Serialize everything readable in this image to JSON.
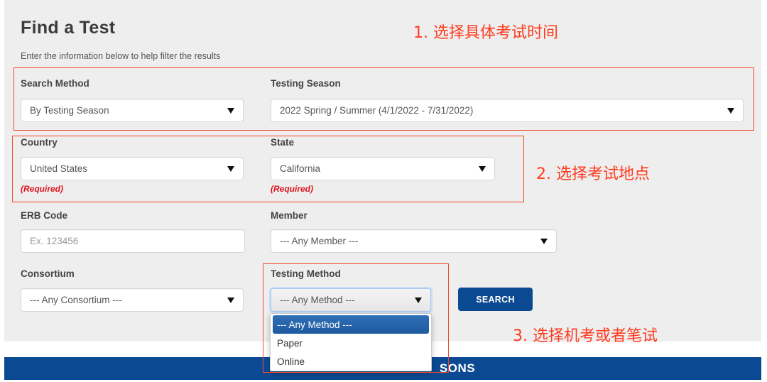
{
  "page": {
    "title": "Find a Test",
    "subtitle": "Enter the information below to help filter the results"
  },
  "fields": {
    "search_method": {
      "label": "Search Method",
      "value": "By Testing Season"
    },
    "testing_season": {
      "label": "Testing Season",
      "value": "2022 Spring / Summer (4/1/2022 - 7/31/2022)"
    },
    "country": {
      "label": "Country",
      "value": "United States",
      "note": "(Required)"
    },
    "state": {
      "label": "State",
      "value": "California",
      "note": "(Required)"
    },
    "erb_code": {
      "label": "ERB Code",
      "value": "",
      "placeholder": "Ex. 123456"
    },
    "member": {
      "label": "Member",
      "value": "--- Any Member ---"
    },
    "consortium": {
      "label": "Consortium",
      "value": "--- Any Consortium ---"
    },
    "testing_method": {
      "label": "Testing Method",
      "value": "--- Any Method ---",
      "options": [
        "--- Any Method ---",
        "Paper",
        "Online"
      ],
      "selected_index": 0,
      "open": true
    }
  },
  "search_button": {
    "label": "SEARCH"
  },
  "banner": {
    "visible_text": "SONS"
  },
  "annotations": [
    {
      "text": "1. 选择具体考试时间"
    },
    {
      "text": "2. 选择考试地点"
    },
    {
      "text": "3. 选择机考或者笔试"
    }
  ],
  "colors": {
    "brand_blue": "#0b4a92",
    "annotation_red": "#ff3b1f",
    "required_red": "#e0141e",
    "panel_bg": "#eeeeee"
  }
}
